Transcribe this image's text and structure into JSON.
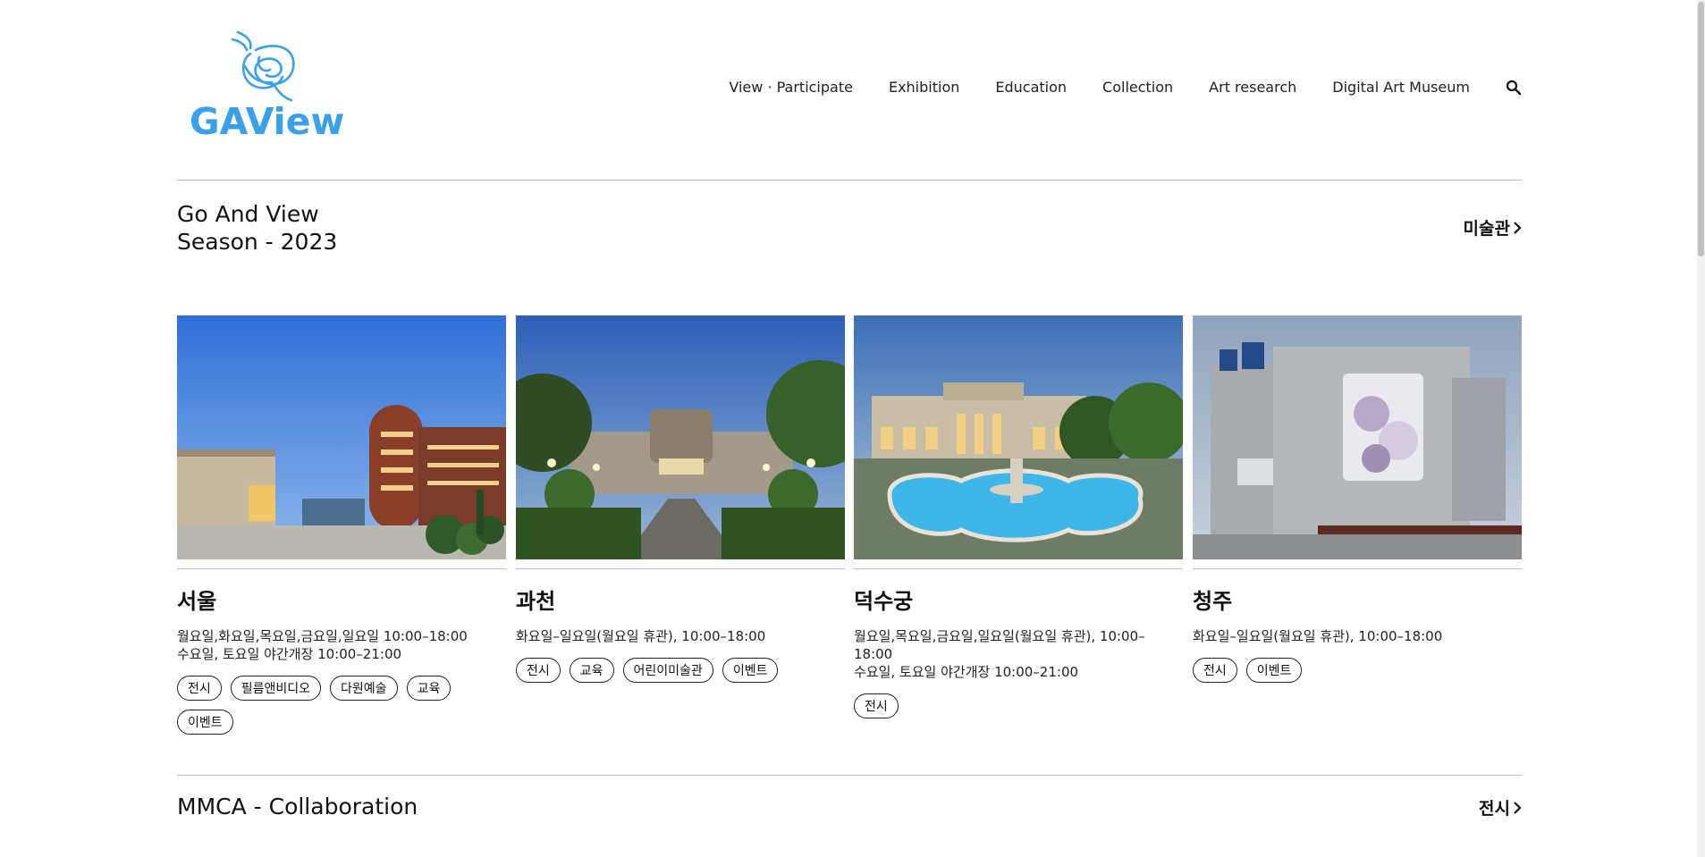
{
  "brand": {
    "name": "GAView",
    "color": "#3aa0e8"
  },
  "nav": {
    "items": [
      "View · Participate",
      "Exhibition",
      "Education",
      "Collection",
      "Art research",
      "Digital Art Museum"
    ],
    "search_icon": "search-icon"
  },
  "section1": {
    "title_line1": "Go And View",
    "title_line2": "Season - 2023",
    "link_label": "미술관"
  },
  "cards": [
    {
      "name": "서울",
      "hours_line1": "월요일,화요일,목요일,금요일,일요일 10:00–18:00",
      "hours_line2": "수요일, 토요일 야간개장 10:00–21:00",
      "tags": [
        "전시",
        "필름앤비디오",
        "다원예술",
        "교육",
        "이벤트"
      ]
    },
    {
      "name": "과천",
      "hours_line1": "화요일–일요일(월요일 휴관), 10:00–18:00",
      "hours_line2": "",
      "tags": [
        "전시",
        "교육",
        "어린이미술관",
        "이벤트"
      ]
    },
    {
      "name": "덕수궁",
      "hours_line1": "월요일,목요일,금요일,일요일(월요일 휴관), 10:00–18:00",
      "hours_line2": "수요일, 토요일 야간개장 10:00–21:00",
      "tags": [
        "전시"
      ]
    },
    {
      "name": "청주",
      "hours_line1": "화요일–일요일(월요일 휴관), 10:00–18:00",
      "hours_line2": "",
      "tags": [
        "전시",
        "이벤트"
      ]
    }
  ],
  "section2": {
    "title": "MMCA - Collaboration",
    "link_label": "전시"
  }
}
